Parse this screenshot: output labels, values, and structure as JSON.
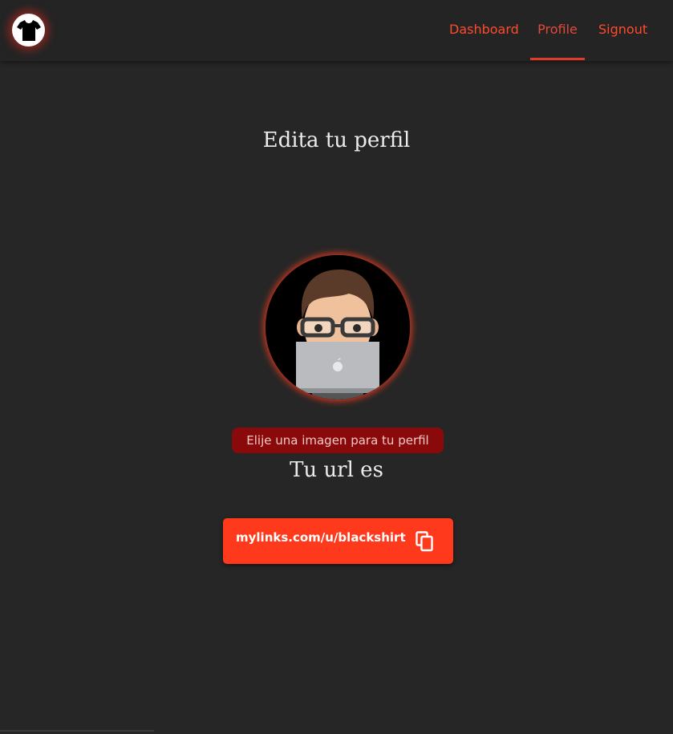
{
  "header": {
    "logo_icon": "tshirt-icon",
    "nav": [
      {
        "label": "Dashboard",
        "active": false
      },
      {
        "label": "Profile",
        "active": true
      },
      {
        "label": "Signout",
        "active": false
      }
    ]
  },
  "main": {
    "title": "Edita tu perfil",
    "avatar_icon": "memoji-avatar",
    "choose_image_label": "Elije una imagen para tu perfil",
    "url_title": "Tu url es",
    "url_value": "mylinks.com/u/blackshirt",
    "copy_icon": "copy-icon"
  },
  "colors": {
    "accent": "#ff3a1c",
    "background": "#262626",
    "choose_button": "#8a0a0c"
  }
}
